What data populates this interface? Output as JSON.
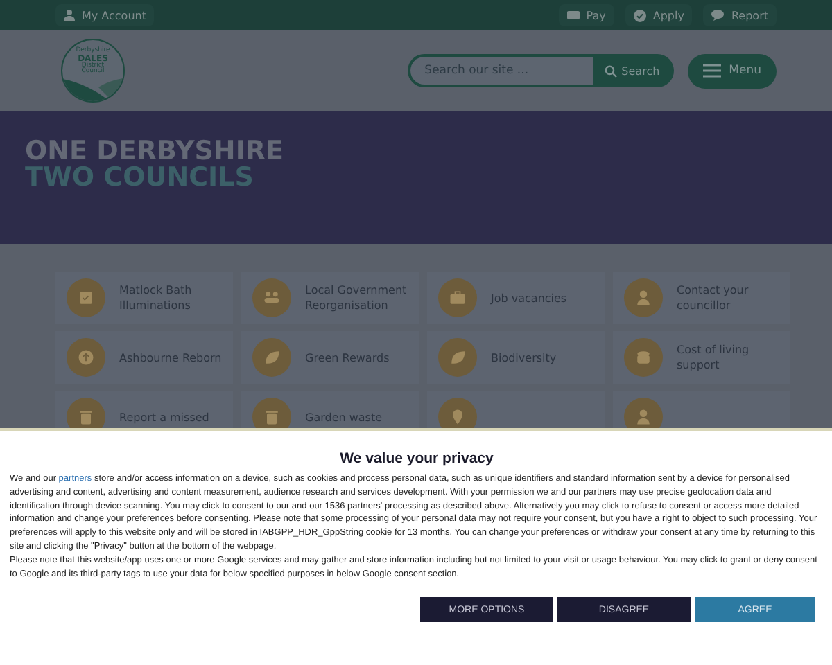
{
  "top_bar": {
    "account": "My Account",
    "links": [
      {
        "label": "Pay",
        "kind": "card"
      },
      {
        "label": "Apply",
        "kind": "check"
      },
      {
        "label": "Report",
        "kind": "chat"
      }
    ]
  },
  "header": {
    "logo": {
      "line_1": "Derbyshire",
      "line_2": "DALES",
      "line_3": "District",
      "line_4": "Council"
    },
    "search": {
      "placeholder": "Search our site ...",
      "button": "Search"
    },
    "menu": "Menu"
  },
  "hero": {
    "line_1": "ONE DERBYSHIRE",
    "line_2": "TWO COUNCILS"
  },
  "tiles": [
    {
      "label": "Matlock Bath Illuminations",
      "kind": "calendar"
    },
    {
      "label": "Local Government Reorganisation",
      "kind": "people"
    },
    {
      "label": "Job vacancies",
      "kind": "briefcase"
    },
    {
      "label": "Contact your councillor",
      "kind": "person"
    },
    {
      "label": "Ashbourne Reborn",
      "kind": "upload"
    },
    {
      "label": "Green Rewards",
      "kind": "leaf"
    },
    {
      "label": "Biodiversity",
      "kind": "leaf"
    },
    {
      "label": "Cost of living support",
      "kind": "coins"
    },
    {
      "label": "Report a missed",
      "kind": "bin"
    },
    {
      "label": "Garden waste",
      "kind": "bin"
    },
    {
      "kind": "pin"
    },
    {
      "kind": "person"
    }
  ],
  "consent": {
    "title": "We value your privacy",
    "paragraphs": [
      {
        "before": "We and our ",
        "link": "partners",
        "after": " store and/or access information on a device, such as cookies and process personal data, such as unique identifiers and standard information sent by a device for personalised advertising and content, advertising and content measurement, audience research and services development. With your permission we and our partners may use precise geolocation data and identification through device scanning. You may click to consent to our and our 1536 partners' processing as described above. Alternatively you may click to refuse to consent or access more detailed information and change your preferences before consenting. Please note that some processing of your personal data may not require your consent, but you have a right to object to such processing. Your preferences will apply to this website only and will be stored in IABGPP_HDR_GppString cookie for 13 months. You can change your preferences or withdraw your consent at any time by returning to this site and clicking the \"Privacy\" button at the bottom of the webpage."
      },
      {
        "before": "Please note that this website/app uses one or more Google services and may gather and store information including but not limited to your visit or usage behaviour. You may click to grant or deny consent to Google and its third-party tags to use your data for below specified purposes in below Google consent section."
      }
    ],
    "buttons": [
      {
        "label": "MORE OPTIONS",
        "kind": "secondary"
      },
      {
        "label": "DISAGREE",
        "kind": "secondary"
      },
      {
        "label": "AGREE",
        "kind": "primary"
      }
    ]
  }
}
